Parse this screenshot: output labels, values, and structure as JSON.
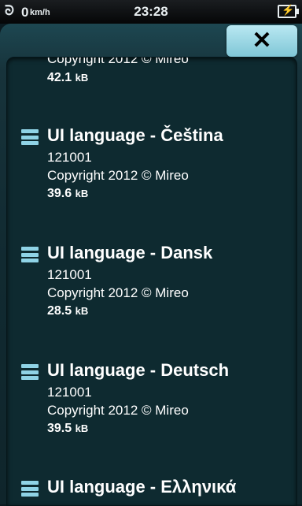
{
  "status_bar": {
    "speed": "0",
    "speed_unit": "km/h",
    "time": "23:28"
  },
  "toolbar": {
    "close_label": "✕"
  },
  "entries": [
    {
      "title": "",
      "version": "",
      "copyright": "Copyright 2012 © Mireo",
      "size": "42.1",
      "size_unit": "kB"
    },
    {
      "title": "UI language - Čeština",
      "version": "121001",
      "copyright": "Copyright 2012 © Mireo",
      "size": "39.6",
      "size_unit": "kB"
    },
    {
      "title": "UI language - Dansk",
      "version": "121001",
      "copyright": "Copyright 2012 © Mireo",
      "size": "28.5",
      "size_unit": "kB"
    },
    {
      "title": "UI language - Deutsch",
      "version": "121001",
      "copyright": "Copyright 2012 © Mireo",
      "size": "39.5",
      "size_unit": "kB"
    },
    {
      "title": "UI language - Ελληνικά",
      "version": "",
      "copyright": "",
      "size": "",
      "size_unit": ""
    }
  ]
}
